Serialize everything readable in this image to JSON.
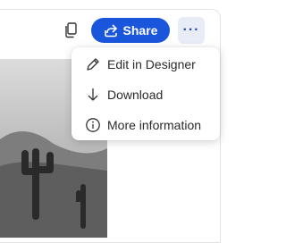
{
  "toolbar": {
    "copy_icon": "copy-icon",
    "share_label": "Share",
    "share_icon": "share-arrow-icon",
    "more_label": "···",
    "accent_color": "#1a56db"
  },
  "menu": {
    "items": [
      {
        "label": "Edit in Designer",
        "icon": "pencil-icon"
      },
      {
        "label": "Download",
        "icon": "download-arrow-icon"
      },
      {
        "label": "More information",
        "icon": "info-icon"
      }
    ]
  },
  "image": {
    "description_icon": "cactus-photo"
  }
}
